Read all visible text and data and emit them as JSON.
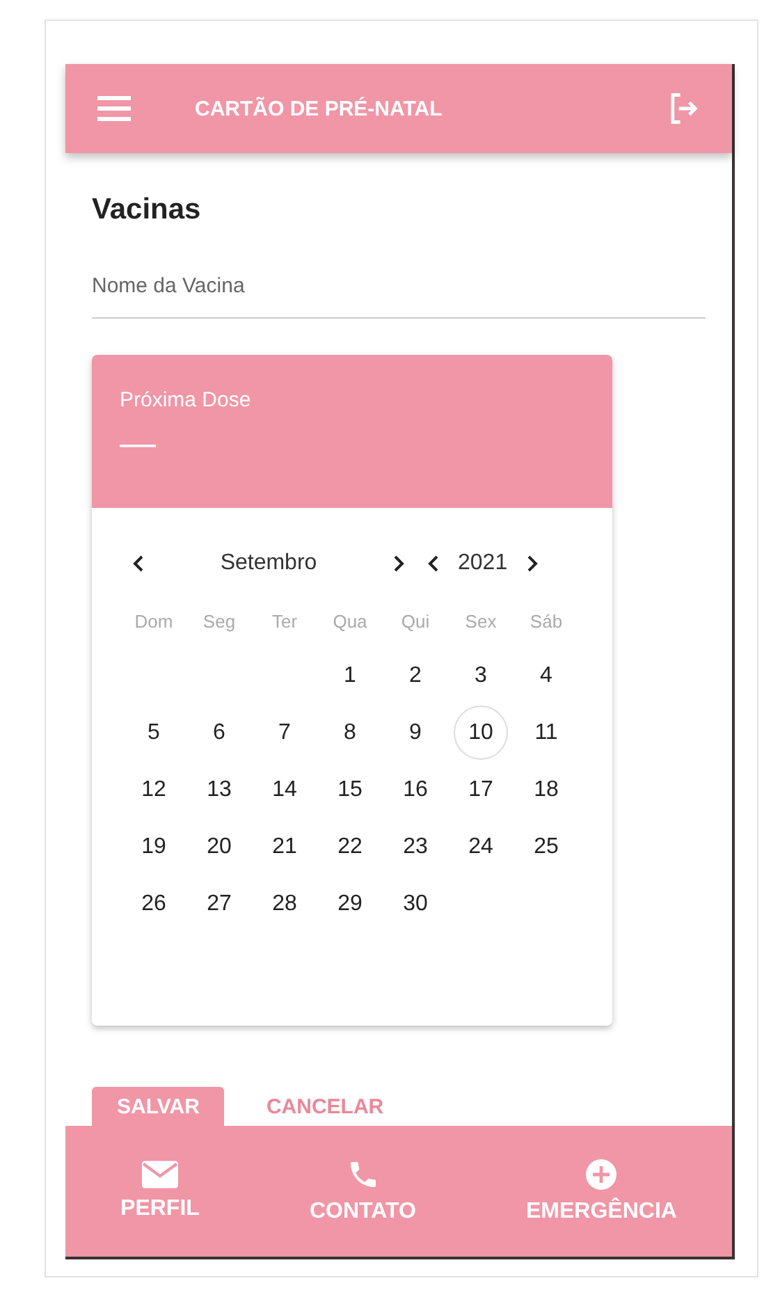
{
  "app_bar": {
    "title": "CARTÃO DE PRÉ-NATAL"
  },
  "page_title": "Vacinas",
  "vaccine_field": {
    "placeholder": "Nome da Vacina"
  },
  "date_picker": {
    "header_label": "Próxima Dose",
    "header_value": "—",
    "month": "Setembro",
    "year": "2021",
    "weekdays": [
      "Dom",
      "Seg",
      "Ter",
      "Qua",
      "Qui",
      "Sex",
      "Sáb"
    ],
    "days": [
      {
        "kind": "blank"
      },
      {
        "kind": "blank"
      },
      {
        "kind": "blank"
      },
      {
        "kind": "day",
        "label": "1",
        "today": false
      },
      {
        "kind": "day",
        "label": "2",
        "today": false
      },
      {
        "kind": "day",
        "label": "3",
        "today": false
      },
      {
        "kind": "day",
        "label": "4",
        "today": false
      },
      {
        "kind": "day",
        "label": "5",
        "today": false
      },
      {
        "kind": "day",
        "label": "6",
        "today": false
      },
      {
        "kind": "day",
        "label": "7",
        "today": false
      },
      {
        "kind": "day",
        "label": "8",
        "today": false
      },
      {
        "kind": "day",
        "label": "9",
        "today": false
      },
      {
        "kind": "day",
        "label": "10",
        "today": true
      },
      {
        "kind": "day",
        "label": "11",
        "today": false
      },
      {
        "kind": "day",
        "label": "12",
        "today": false
      },
      {
        "kind": "day",
        "label": "13",
        "today": false
      },
      {
        "kind": "day",
        "label": "14",
        "today": false
      },
      {
        "kind": "day",
        "label": "15",
        "today": false
      },
      {
        "kind": "day",
        "label": "16",
        "today": false
      },
      {
        "kind": "day",
        "label": "17",
        "today": false
      },
      {
        "kind": "day",
        "label": "18",
        "today": false
      },
      {
        "kind": "day",
        "label": "19",
        "today": false
      },
      {
        "kind": "day",
        "label": "20",
        "today": false
      },
      {
        "kind": "day",
        "label": "21",
        "today": false
      },
      {
        "kind": "day",
        "label": "22",
        "today": false
      },
      {
        "kind": "day",
        "label": "23",
        "today": false
      },
      {
        "kind": "day",
        "label": "24",
        "today": false
      },
      {
        "kind": "day",
        "label": "25",
        "today": false
      },
      {
        "kind": "day",
        "label": "26",
        "today": false
      },
      {
        "kind": "day",
        "label": "27",
        "today": false
      },
      {
        "kind": "day",
        "label": "28",
        "today": false
      },
      {
        "kind": "day",
        "label": "29",
        "today": false
      },
      {
        "kind": "day",
        "label": "30",
        "today": false
      }
    ]
  },
  "actions": [
    {
      "label": "SALVAR",
      "kind": "filled"
    },
    {
      "label": "CANCELAR",
      "kind": "text"
    }
  ],
  "bottom_nav": [
    {
      "label": "PERFIL"
    },
    {
      "label": "CONTATO"
    },
    {
      "label": "EMERGÊNCIA"
    }
  ]
}
